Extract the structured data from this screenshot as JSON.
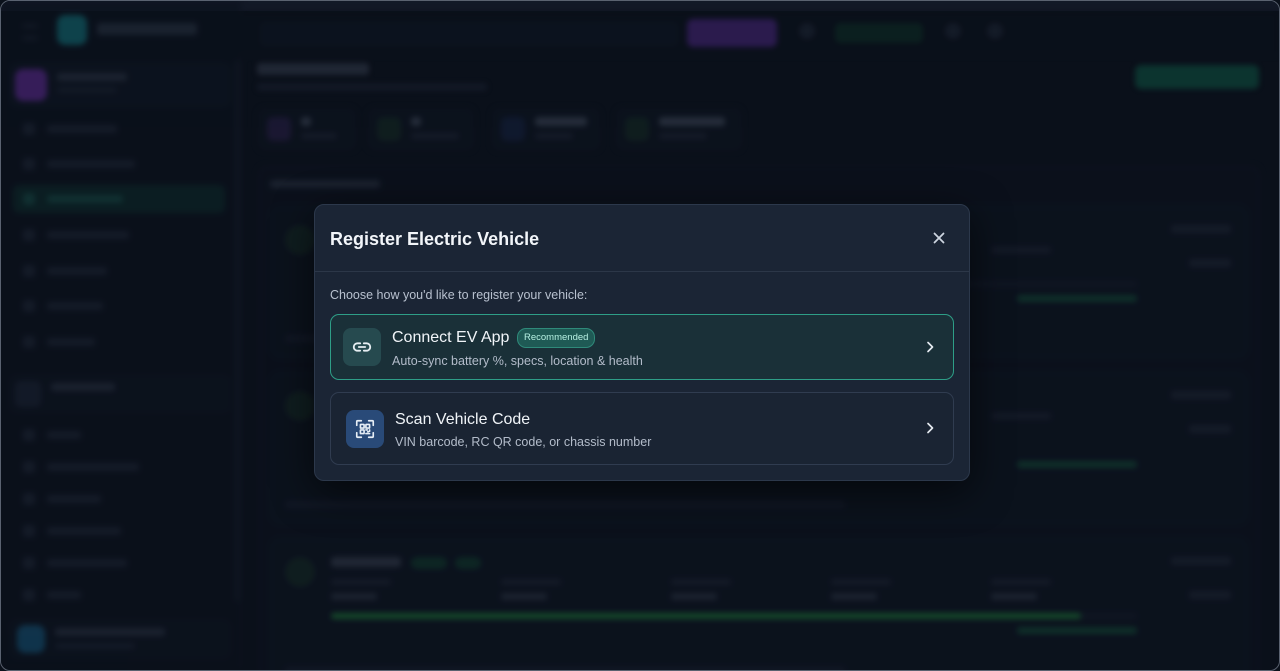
{
  "modal": {
    "title": "Register Electric Vehicle",
    "subtitle": "Choose how you'd like to register your vehicle:",
    "options": [
      {
        "title": "Connect EV App",
        "badge": "Recommended",
        "description": "Auto-sync battery %, specs, location & health",
        "icon": "link-icon"
      },
      {
        "title": "Scan Vehicle Code",
        "description": "VIN barcode, RC QR code, or chassis number",
        "icon": "qr-scan-icon"
      }
    ]
  },
  "colors": {
    "accent": "#2e9e87",
    "modal_bg": "#1b2535",
    "page_bg": "#0d141f"
  }
}
